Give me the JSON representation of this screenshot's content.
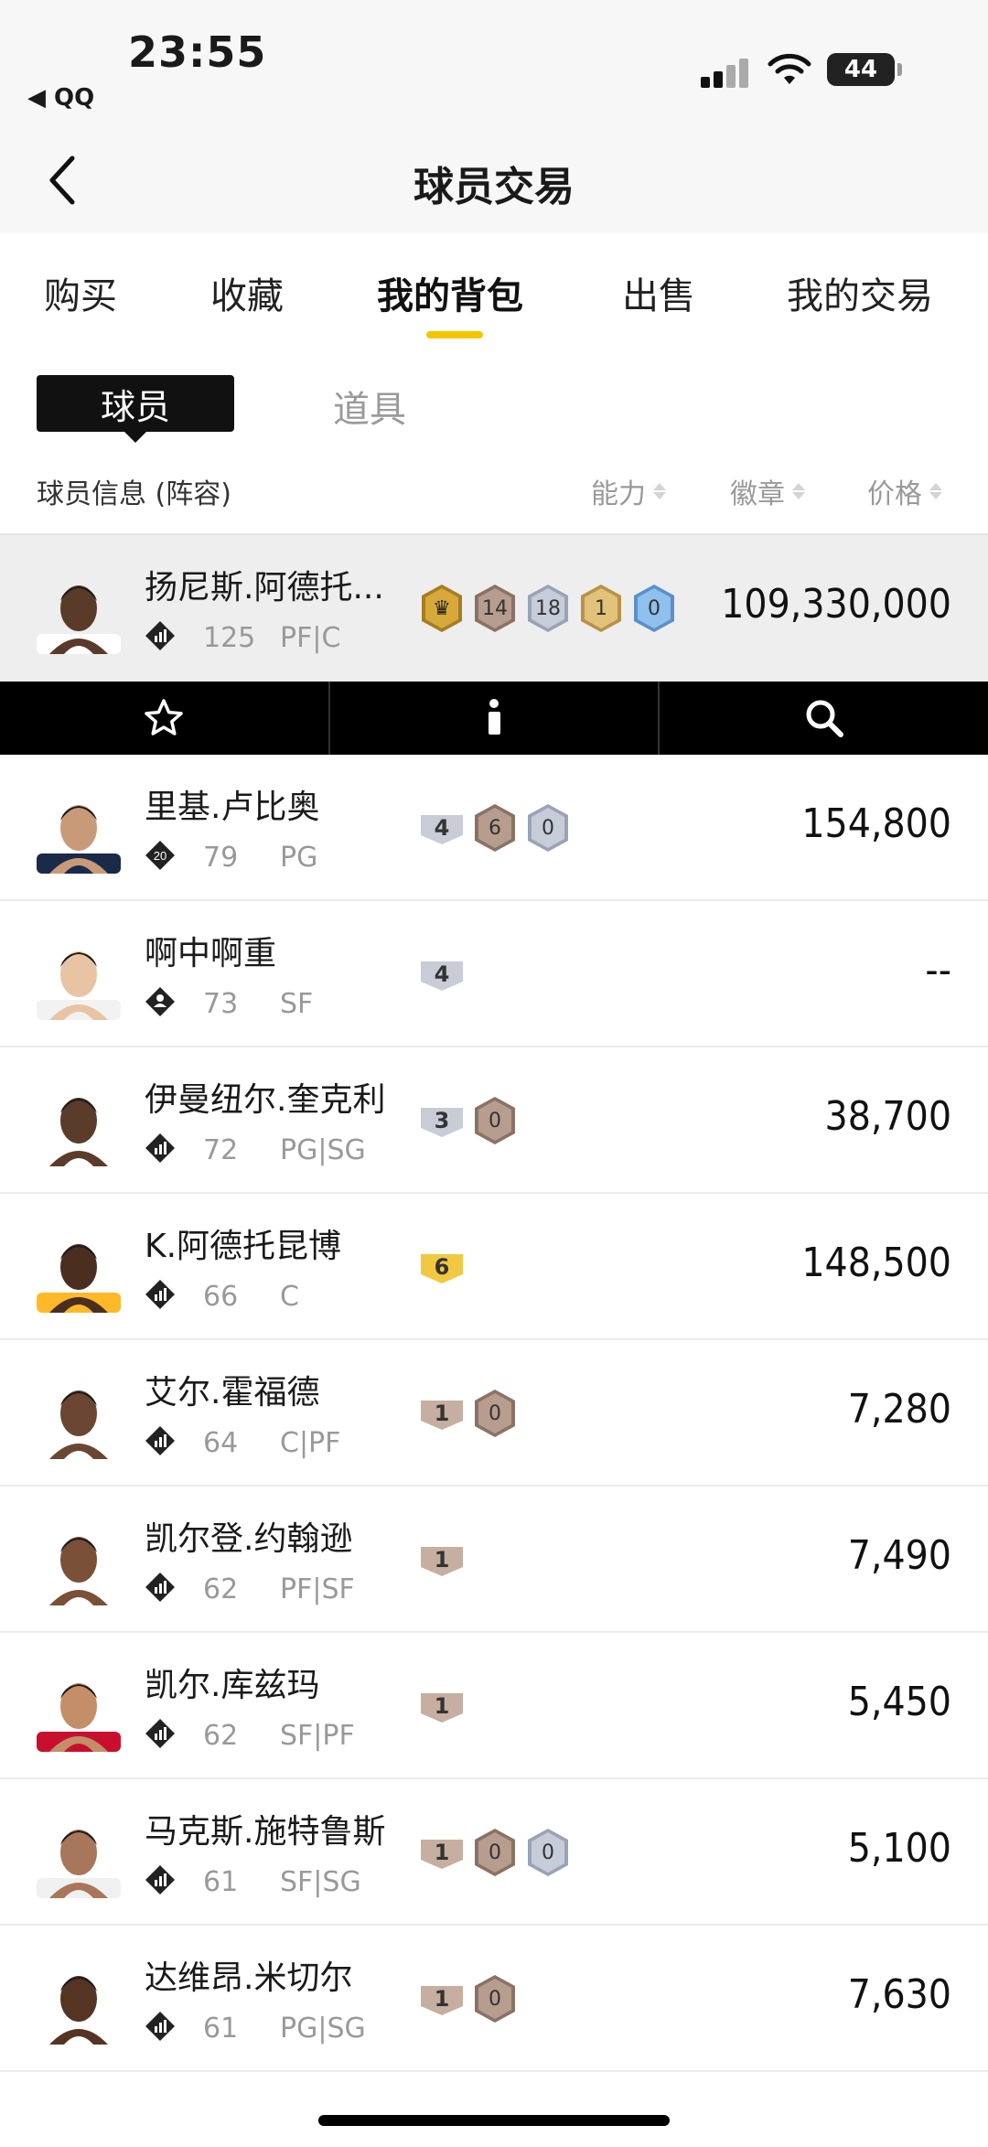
{
  "status_bar": {
    "time": "23:55",
    "back_app": "◀ QQ",
    "battery": "44"
  },
  "nav": {
    "title": "球员交易"
  },
  "main_tabs": [
    {
      "label": "购买",
      "active": false
    },
    {
      "label": "收藏",
      "active": false
    },
    {
      "label": "我的背包",
      "active": true
    },
    {
      "label": "出售",
      "active": false
    },
    {
      "label": "我的交易",
      "active": false
    }
  ],
  "sub_tabs": {
    "active": "球员",
    "other": "道具"
  },
  "columns": {
    "info": "球员信息 (阵容)",
    "ability": "能力",
    "badge": "徽章",
    "price": "价格"
  },
  "colors": {
    "accent": "#f5c400",
    "gold_badge": "#d9b25c",
    "bronze_badge": "#b79d8e",
    "silver_badge": "#b8c0d0",
    "blue_badge": "#6aa6e0"
  },
  "players": [
    {
      "name": "扬尼斯.阿德托...",
      "rating": "125",
      "pos": "PF|C",
      "icon": "team-icon",
      "price": "109,330,000",
      "selected": true,
      "badges": [
        {
          "type": "crown",
          "text": "♛"
        },
        {
          "type": "bronze",
          "text": "14"
        },
        {
          "type": "silver",
          "text": "18"
        },
        {
          "type": "gold",
          "text": "1"
        },
        {
          "type": "blue",
          "text": "0"
        }
      ]
    },
    {
      "name": "里基.卢比奥",
      "rating": "79",
      "pos": "PG",
      "icon": "level-20-icon",
      "level": "20",
      "price": "154,800",
      "badges": [
        {
          "type": "flat-silver",
          "text": "4"
        },
        {
          "type": "bronze",
          "text": "6"
        },
        {
          "type": "silver",
          "text": "0"
        }
      ]
    },
    {
      "name": "啊中啊重",
      "rating": "73",
      "pos": "SF",
      "icon": "person-icon",
      "price": "--",
      "badges": [
        {
          "type": "flat-silver",
          "text": "4"
        }
      ]
    },
    {
      "name": "伊曼纽尔.奎克利",
      "rating": "72",
      "pos": "PG|SG",
      "icon": "team-icon",
      "price": "38,700",
      "badges": [
        {
          "type": "flat-silver",
          "text": "3"
        },
        {
          "type": "bronze",
          "text": "0"
        }
      ]
    },
    {
      "name": "K.阿德托昆博",
      "rating": "66",
      "pos": "C",
      "icon": "team-icon",
      "price": "148,500",
      "badges": [
        {
          "type": "flat-gold",
          "text": "6"
        }
      ]
    },
    {
      "name": "艾尔.霍福德",
      "rating": "64",
      "pos": "C|PF",
      "icon": "team-icon",
      "price": "7,280",
      "badges": [
        {
          "type": "flat-bronze",
          "text": "1"
        },
        {
          "type": "bronze",
          "text": "0"
        }
      ]
    },
    {
      "name": "凯尔登.约翰逊",
      "rating": "62",
      "pos": "PF|SF",
      "icon": "team-icon",
      "price": "7,490",
      "badges": [
        {
          "type": "flat-bronze",
          "text": "1"
        }
      ]
    },
    {
      "name": "凯尔.库兹玛",
      "rating": "62",
      "pos": "SF|PF",
      "icon": "team-icon",
      "price": "5,450",
      "badges": [
        {
          "type": "flat-bronze",
          "text": "1"
        }
      ]
    },
    {
      "name": "马克斯.施特鲁斯",
      "rating": "61",
      "pos": "SF|SG",
      "icon": "team-icon",
      "price": "5,100",
      "badges": [
        {
          "type": "flat-bronze",
          "text": "1"
        },
        {
          "type": "bronze",
          "text": "0"
        },
        {
          "type": "silver",
          "text": "0"
        }
      ]
    },
    {
      "name": "达维昂.米切尔",
      "rating": "61",
      "pos": "PG|SG",
      "icon": "team-icon",
      "price": "7,630",
      "badges": [
        {
          "type": "flat-bronze",
          "text": "1"
        },
        {
          "type": "bronze",
          "text": "0"
        }
      ]
    }
  ],
  "actions": [
    {
      "icon": "star-icon"
    },
    {
      "icon": "info-icon"
    },
    {
      "icon": "search-icon"
    }
  ]
}
